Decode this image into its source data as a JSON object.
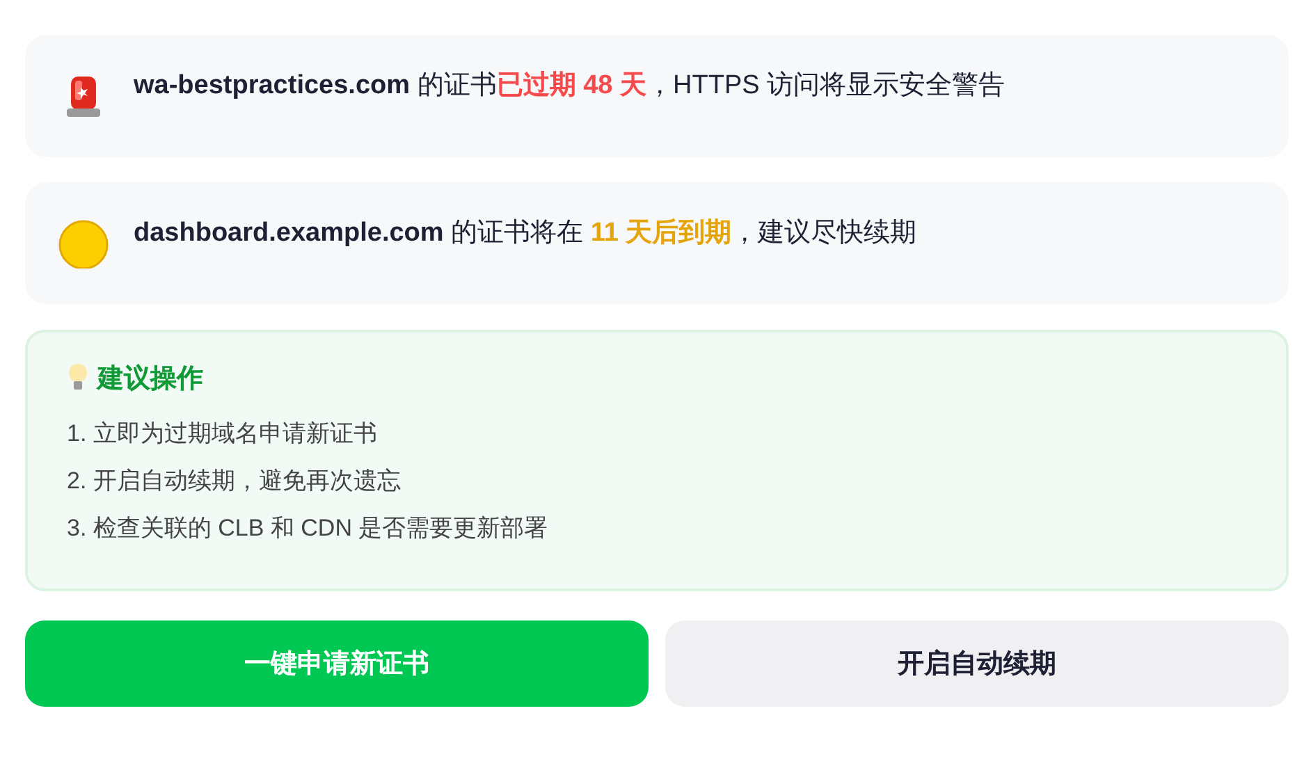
{
  "alerts": [
    {
      "kind": "expired",
      "domain": "wa-bestpractices.com",
      "text_before": " 的证书",
      "highlight": "已过期 48 天",
      "text_after": "，HTTPS 访问将显示安全警告"
    },
    {
      "kind": "warning",
      "domain": "dashboard.example.com",
      "text_before": " 的证书将在 ",
      "highlight": "11 天后到期",
      "text_after": "，建议尽快续期"
    }
  ],
  "suggestions": {
    "title": "建议操作",
    "items": [
      "1. 立即为过期域名申请新证书",
      "2. 开启自动续期，避免再次遗忘",
      "3. 检查关联的 CLB 和 CDN 是否需要更新部署"
    ]
  },
  "buttons": [
    {
      "kind": "primary",
      "label": "一键申请新证书"
    },
    {
      "kind": "secondary",
      "label": "开启自动续期"
    }
  ]
}
